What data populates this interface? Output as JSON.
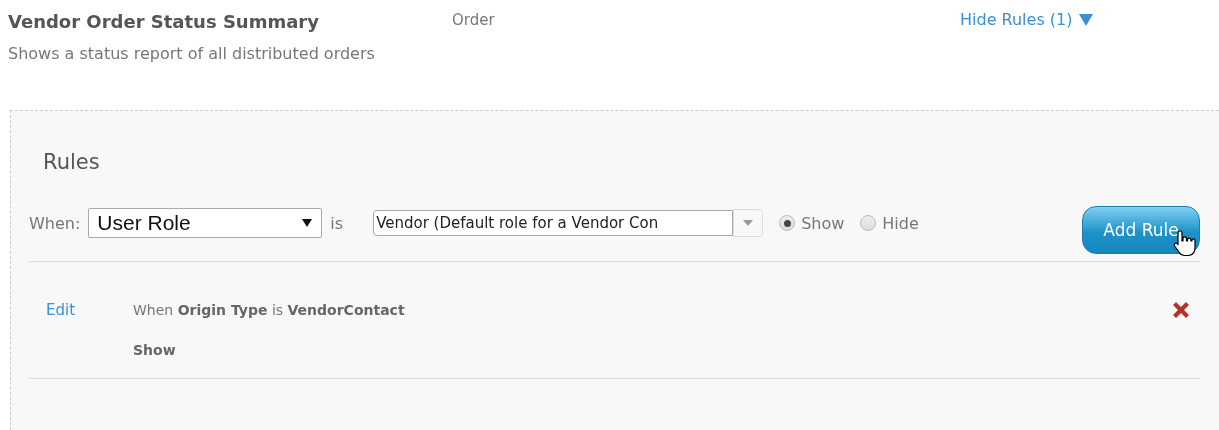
{
  "report": {
    "title": "Vendor Order Status Summary",
    "description": "Shows a status report of all distributed orders",
    "category": "Order",
    "toggle_link": "Hide Rules (1)",
    "expanded": true
  },
  "rules_panel": {
    "heading": "Rules",
    "new_rule": {
      "when_label": "When:",
      "field": "User Role",
      "operator": "is",
      "value": "Vendor (Default role for a Vendor Con",
      "visibility": [
        {
          "label": "Show",
          "selected": true
        },
        {
          "label": "Hide",
          "selected": false
        }
      ],
      "add_button": "Add Rule"
    },
    "rules": [
      {
        "edit_link": "Edit",
        "condition": "When **Origin Type** is **VendorContact**",
        "action": "Show"
      }
    ]
  }
}
